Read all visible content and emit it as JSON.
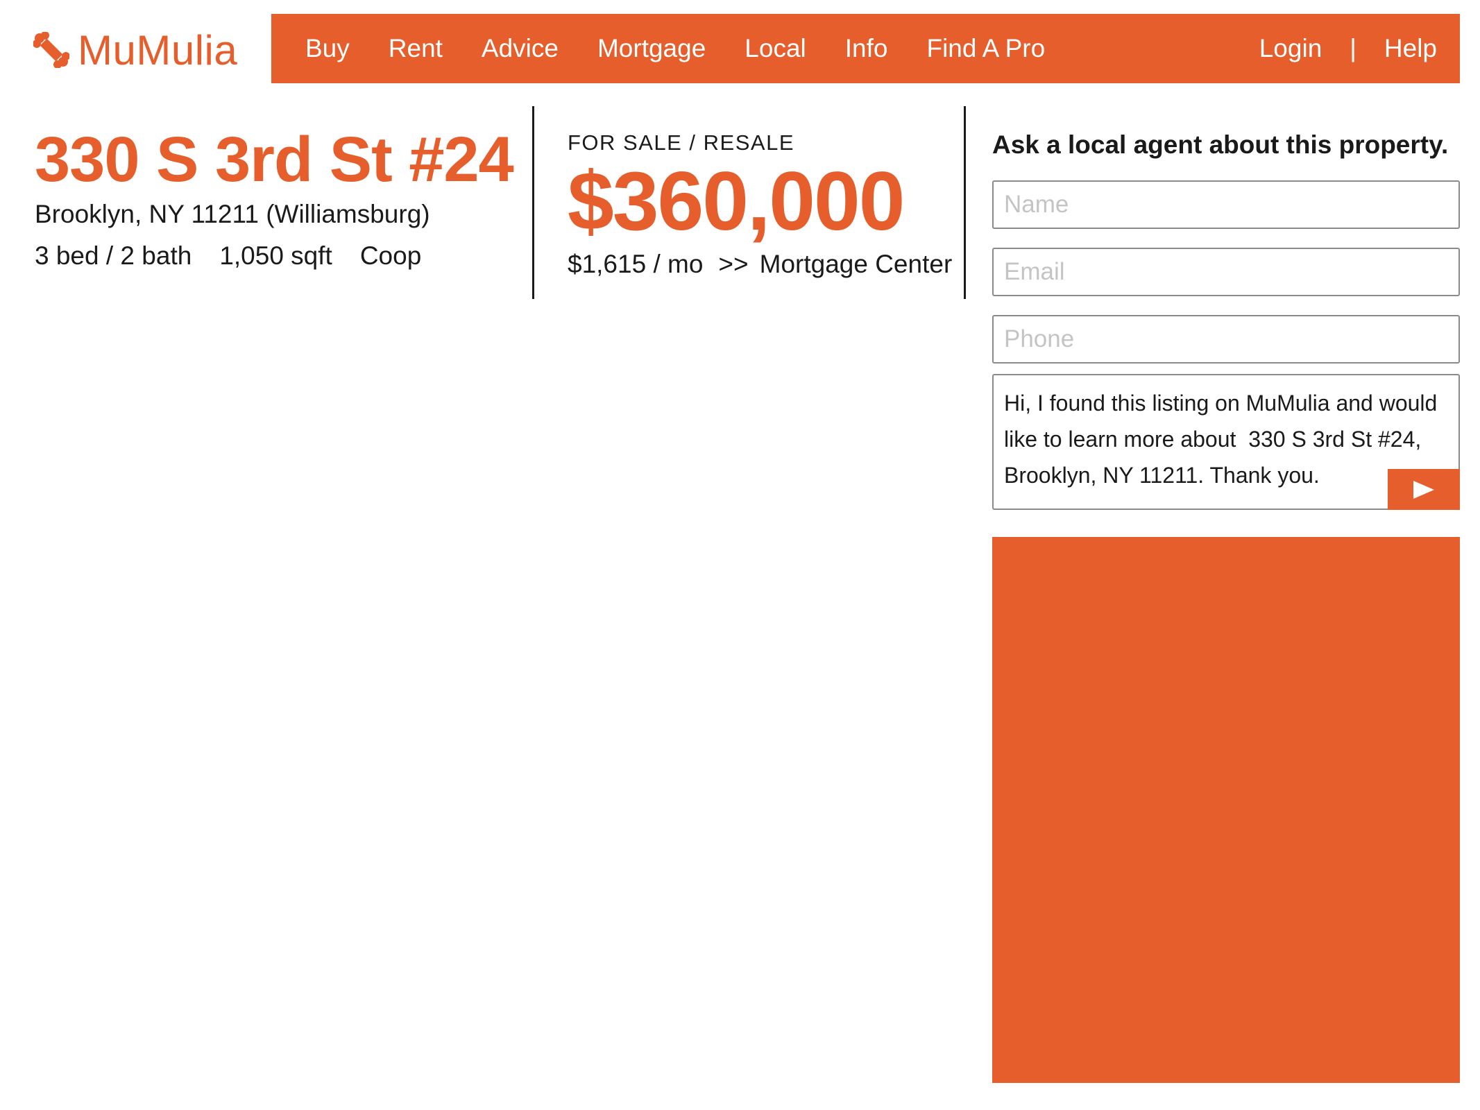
{
  "brand": {
    "name": "MuMulia",
    "icon": "bone-icon",
    "accent_color": "#e55e2b"
  },
  "nav": {
    "links": [
      "Buy",
      "Rent",
      "Advice",
      "Mortgage",
      "Local",
      "Info",
      "Find A Pro"
    ],
    "login": "Login",
    "separator": "|",
    "help": "Help"
  },
  "listing": {
    "address": "330 S 3rd St #24",
    "city_line": "Brooklyn, NY 11211 (Williamsburg)",
    "beds_baths": "3 bed / 2 bath",
    "sqft": "1,050 sqft",
    "type": "Coop",
    "sale_type": "FOR SALE / RESALE",
    "price": "$360,000",
    "monthly": "$1,615 / mo",
    "mortgage_arrow": ">>",
    "mortgage_link": "Mortgage Center"
  },
  "contact": {
    "heading": "Ask a local agent about this property.",
    "name_placeholder": "Name",
    "email_placeholder": "Email",
    "phone_placeholder": "Phone",
    "message": "Hi, I found this listing on MuMulia and would like to learn more about  330 S 3rd St #24, Brooklyn, NY 11211. Thank you.",
    "send_icon": "play-arrow-icon"
  }
}
